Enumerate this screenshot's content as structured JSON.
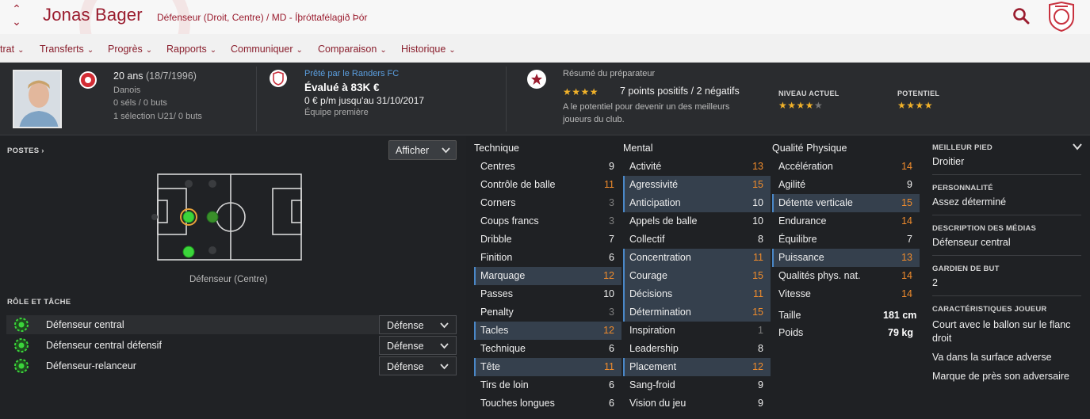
{
  "header": {
    "name": "Jonas Bager",
    "subtitle": "Défenseur (Droit, Centre) / MD - Íþróttafélagið Þór"
  },
  "menu": [
    "trat",
    "Transferts",
    "Progrès",
    "Rapports",
    "Communiquer",
    "Comparaison",
    "Historique"
  ],
  "bio": {
    "age": "20 ans",
    "dob": "(18/7/1996)",
    "nation": "Danois",
    "caps": "0 séls / 0 buts",
    "u21": "1 sélection U21/ 0 buts"
  },
  "contract": {
    "loan": "Prêté par le Randers FC",
    "value": "Évalué à 83K €",
    "wage": "0 € p/m jusqu'au 31/10/2017",
    "squad": "Équipe première"
  },
  "scout": {
    "title": "Résumé du préparateur",
    "points": "7 points positifs / 2 négatifs",
    "text1": "A le potentiel pour devenir un des meilleurs",
    "text2": "joueurs du club.",
    "current_label": "NIVEAU ACTUEL",
    "potential_label": "POTENTIEL",
    "summary_stars": 4,
    "current_stars": 4,
    "current_stars_total": 5,
    "potential_stars": 4
  },
  "positions": {
    "label": "POSTES",
    "show_button": "Afficher",
    "caption": "Défenseur (Centre)"
  },
  "roles": {
    "label": "RÔLE ET TÂCHE",
    "items": [
      {
        "name": "Défenseur central",
        "duty": "Défense"
      },
      {
        "name": "Défenseur central défensif",
        "duty": "Défense"
      },
      {
        "name": "Défenseur-relanceur",
        "duty": "Défense"
      }
    ]
  },
  "technical": {
    "title": "Technique",
    "attrs": [
      {
        "n": "Centres",
        "v": "9",
        "c": "w",
        "h": false
      },
      {
        "n": "Contrôle de balle",
        "v": "11",
        "c": "o",
        "h": false
      },
      {
        "n": "Corners",
        "v": "3",
        "c": "g",
        "h": false
      },
      {
        "n": "Coups francs",
        "v": "3",
        "c": "g",
        "h": false
      },
      {
        "n": "Dribble",
        "v": "7",
        "c": "w",
        "h": false
      },
      {
        "n": "Finition",
        "v": "6",
        "c": "w",
        "h": false
      },
      {
        "n": "Marquage",
        "v": "12",
        "c": "o",
        "h": true
      },
      {
        "n": "Passes",
        "v": "10",
        "c": "w",
        "h": false
      },
      {
        "n": "Penalty",
        "v": "3",
        "c": "g",
        "h": false
      },
      {
        "n": "Tacles",
        "v": "12",
        "c": "o",
        "h": true
      },
      {
        "n": "Technique",
        "v": "6",
        "c": "w",
        "h": false
      },
      {
        "n": "Tête",
        "v": "11",
        "c": "o",
        "h": true
      },
      {
        "n": "Tirs de loin",
        "v": "6",
        "c": "w",
        "h": false
      },
      {
        "n": "Touches longues",
        "v": "6",
        "c": "w",
        "h": false
      }
    ]
  },
  "mental": {
    "title": "Mental",
    "attrs": [
      {
        "n": "Activité",
        "v": "13",
        "c": "o",
        "h": false
      },
      {
        "n": "Agressivité",
        "v": "15",
        "c": "o",
        "h": true
      },
      {
        "n": "Anticipation",
        "v": "10",
        "c": "w",
        "h": true
      },
      {
        "n": "Appels de balle",
        "v": "10",
        "c": "w",
        "h": false
      },
      {
        "n": "Collectif",
        "v": "8",
        "c": "w",
        "h": false
      },
      {
        "n": "Concentration",
        "v": "11",
        "c": "o",
        "h": true
      },
      {
        "n": "Courage",
        "v": "15",
        "c": "o",
        "h": true
      },
      {
        "n": "Décisions",
        "v": "11",
        "c": "o",
        "h": true
      },
      {
        "n": "Détermination",
        "v": "15",
        "c": "o",
        "h": true
      },
      {
        "n": "Inspiration",
        "v": "1",
        "c": "g",
        "h": false
      },
      {
        "n": "Leadership",
        "v": "8",
        "c": "w",
        "h": false
      },
      {
        "n": "Placement",
        "v": "12",
        "c": "o",
        "h": true
      },
      {
        "n": "Sang-froid",
        "v": "9",
        "c": "w",
        "h": false
      },
      {
        "n": "Vision du jeu",
        "v": "9",
        "c": "w",
        "h": false
      }
    ]
  },
  "physical": {
    "title": "Qualité Physique",
    "attrs": [
      {
        "n": "Accélération",
        "v": "14",
        "c": "o",
        "h": false
      },
      {
        "n": "Agilité",
        "v": "9",
        "c": "w",
        "h": false
      },
      {
        "n": "Détente verticale",
        "v": "15",
        "c": "o",
        "h": true
      },
      {
        "n": "Endurance",
        "v": "14",
        "c": "o",
        "h": false
      },
      {
        "n": "Équilibre",
        "v": "7",
        "c": "w",
        "h": false
      },
      {
        "n": "Puissance",
        "v": "13",
        "c": "o",
        "h": true
      },
      {
        "n": "Qualités phys. nat.",
        "v": "14",
        "c": "o",
        "h": false
      },
      {
        "n": "Vitesse",
        "v": "14",
        "c": "o",
        "h": false
      }
    ],
    "height_label": "Taille",
    "height": "181 cm",
    "weight_label": "Poids",
    "weight": "79 kg"
  },
  "side": [
    {
      "h": "MEILLEUR PIED",
      "b": "Droitier"
    },
    {
      "h": "PERSONNALITÉ",
      "b": "Assez déterminé"
    },
    {
      "h": "DESCRIPTION DES MÉDIAS",
      "b": "Défenseur central"
    },
    {
      "h": "GARDIEN DE BUT",
      "b": "2"
    },
    {
      "h": "CARACTÉRISTIQUES JOUEUR",
      "b": ""
    }
  ],
  "traits": [
    "Court avec le ballon sur le flanc droit",
    "Va dans la surface adverse",
    "Marque de près son adversaire"
  ],
  "colors": {
    "accent": "#9a1c2e",
    "orange": "#ef8b2c",
    "highlight": "#35404d",
    "star": "#f0b12a"
  }
}
